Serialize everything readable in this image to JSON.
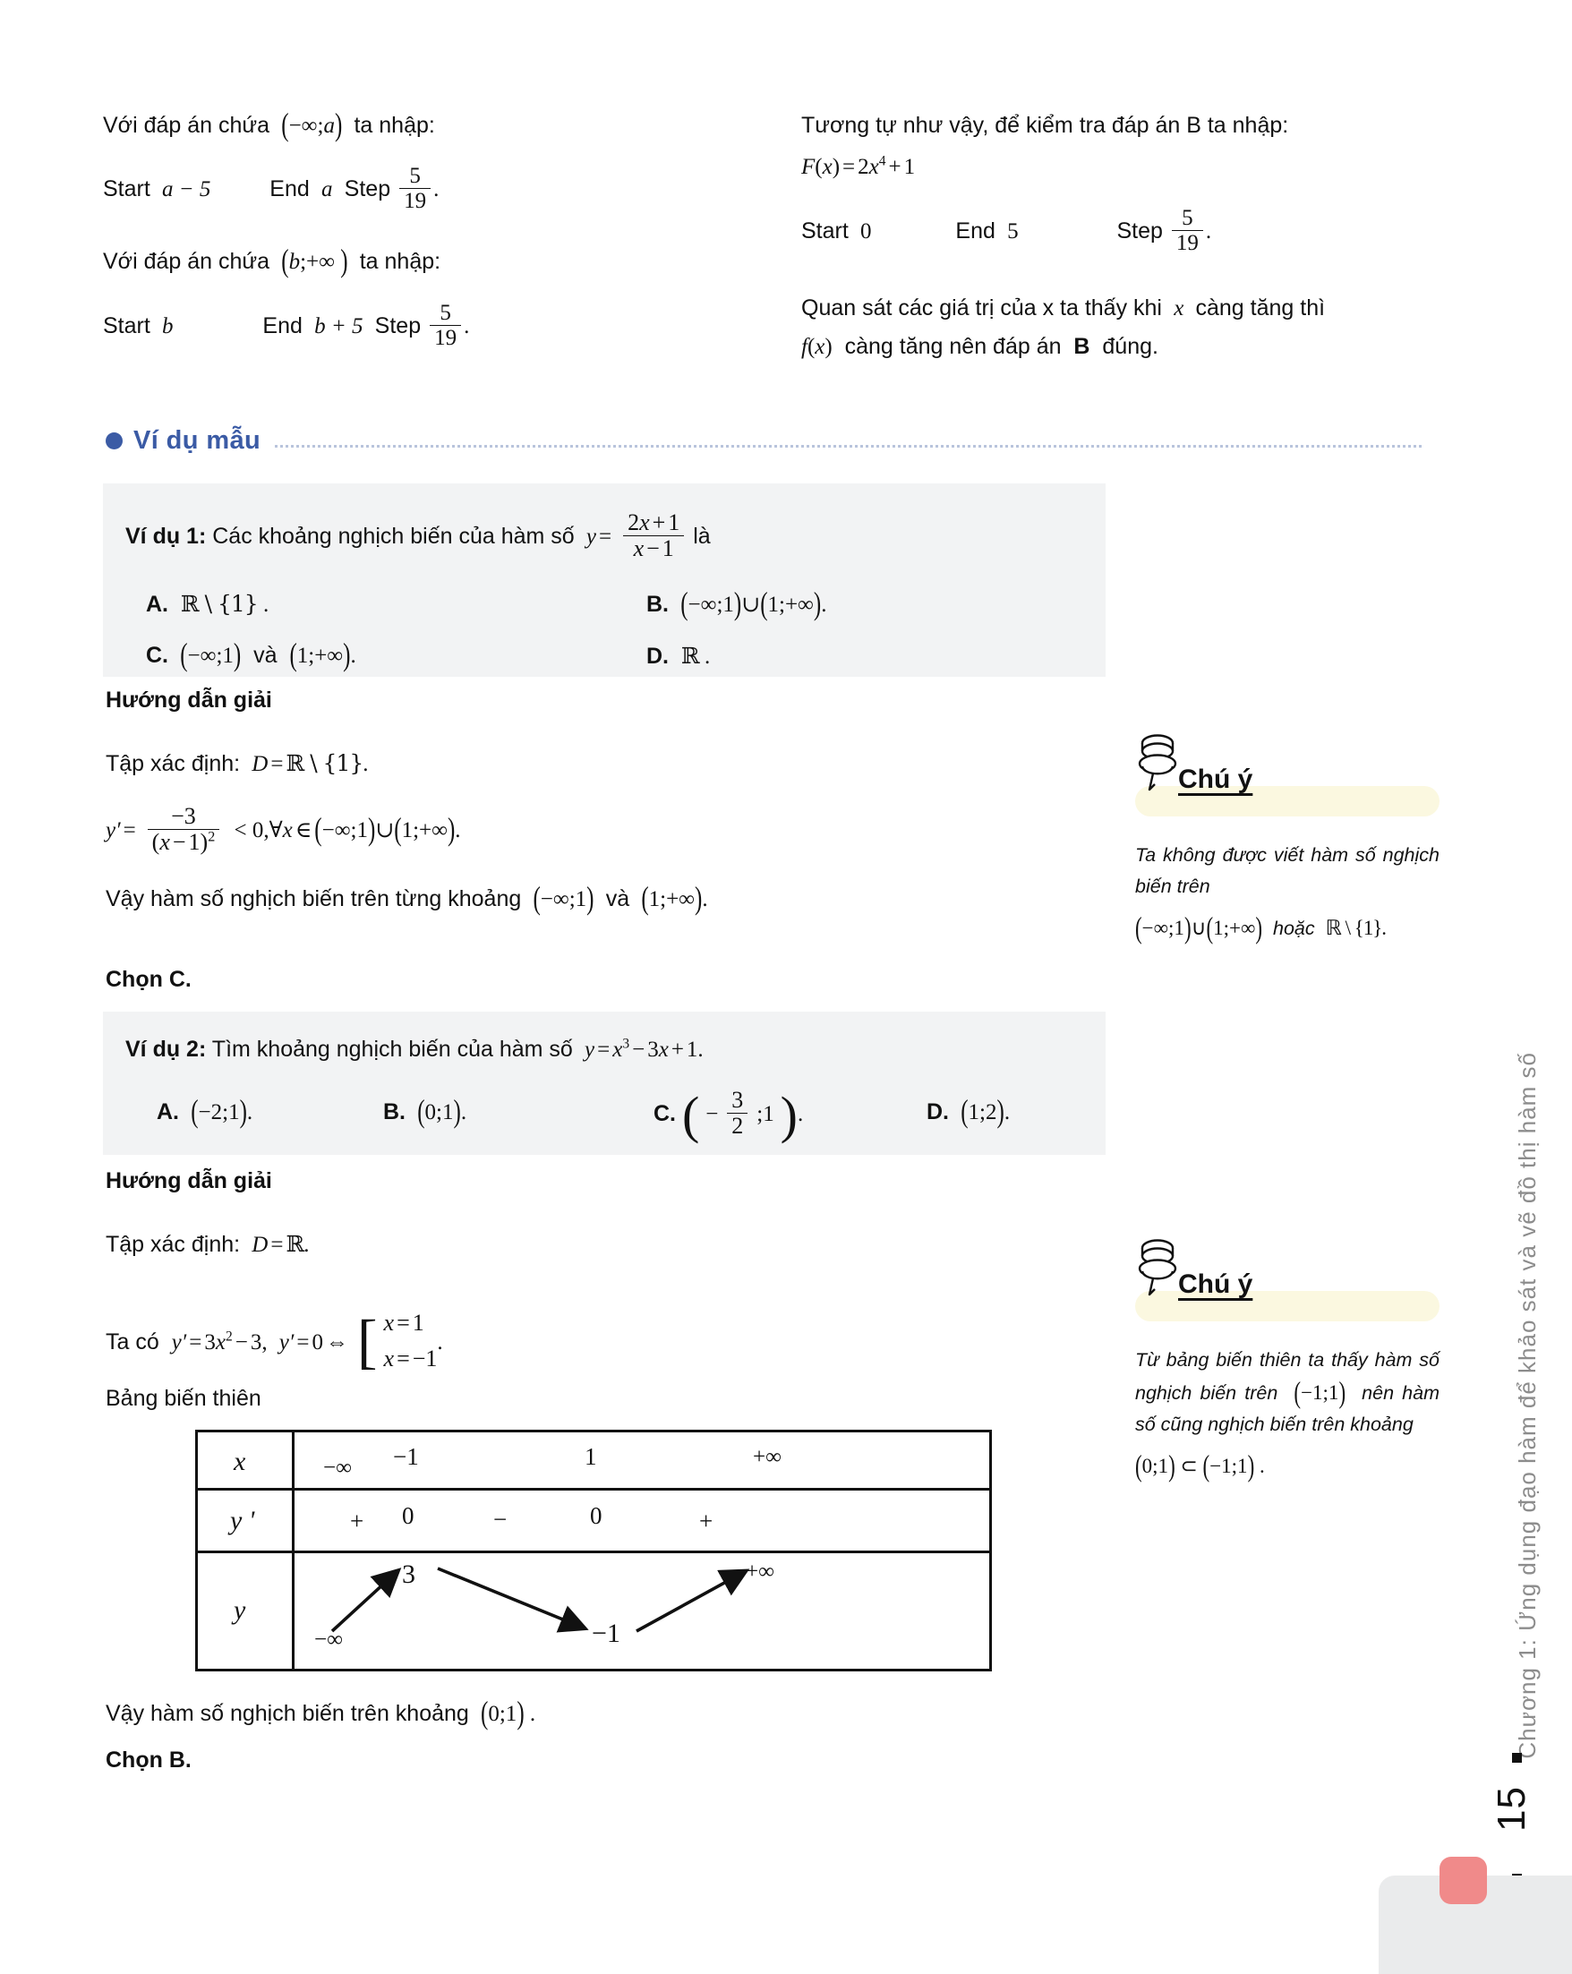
{
  "intro": {
    "left": [
      {
        "id": "l1",
        "text": "Với đáp án chứa (−∞;a) ta nhập:"
      },
      {
        "id": "l2",
        "text": "Start a − 5      End a  Step 5/19."
      },
      {
        "id": "l3",
        "text": "Với đáp án chứa (b;+∞ ) ta nhập:"
      },
      {
        "id": "l4",
        "text": "Start b          End b + 5  Step 5/19."
      }
    ],
    "right": [
      {
        "id": "r1",
        "text": "Tương tự như vậy, để kiểm tra đáp án B ta nhập:"
      },
      {
        "id": "r2",
        "text": "F(x) = 2x⁴ + 1"
      },
      {
        "id": "r3",
        "text": "Start 0          End 5            Step 5/19."
      },
      {
        "id": "r4",
        "text": "Quan sát các giá trị của x ta thấy khi x càng tăng thì f(x) càng tăng nên đáp án B đúng."
      }
    ],
    "labels": {
      "start": "Start",
      "end": "End",
      "step": "Step",
      "with_answer_a": "Với đáp án chứa",
      "with_answer_b": "Với đáp án chứa",
      "ta_nhap": "ta nhập:",
      "similarly": "Tương tự như vậy, để kiểm tra đáp án B ta nhập:",
      "observe_1": "Quan sát các giá trị của x ta thấy khi",
      "observe_2": "càng tăng thì",
      "observe_3": "càng tăng nên đáp án",
      "observe_4": "đúng.",
      "answer_letter_B": "B",
      "start_a_val": "a − 5",
      "end_a_val": "a",
      "start_b_val": "b",
      "end_b_val": "b + 5",
      "start_0": "0",
      "end_5": "5",
      "frac_num": "5",
      "frac_den": "19"
    }
  },
  "section": {
    "title": "Ví dụ mẫu"
  },
  "example1": {
    "label": "Ví dụ 1:",
    "stem_before": "Các khoảng nghịch biến của hàm số",
    "formula_num": "2x + 1",
    "formula_den": "x − 1",
    "stem_after": "là",
    "options": [
      {
        "key": "A.",
        "text": "ℝ \\ {1} ."
      },
      {
        "key": "B.",
        "text": "(−∞;1) ∪ (1;+∞)."
      },
      {
        "key": "C.",
        "text": "(−∞;1) và (1;+∞)."
      },
      {
        "key": "D.",
        "text": "ℝ ."
      }
    ]
  },
  "solution1": {
    "heading": "Hướng dẫn giải",
    "domain_label": "Tập xác định:",
    "domain_value": "D = ℝ \\ {1}.",
    "derivative": "y′ = −3 / (x − 1)² < 0, ∀x ∈ (−∞;1) ∪ (1;+∞).",
    "derivative_num": "−3",
    "derivative_den": "(x − 1)²",
    "derivative_tail": "< 0, ∀x ∈ (−∞;1) ∪ (1;+∞).",
    "conclusion": "Vậy hàm số nghịch biến trên từng khoảng (−∞;1) và (1;+∞).",
    "conclusion_before": "Vậy hàm số nghịch biến trên từng khoảng",
    "conclusion_interval1": "(−∞;1)",
    "conclusion_and": "và",
    "conclusion_interval2": "(1;+∞).",
    "choice": "Chọn C."
  },
  "note1": {
    "title": "Chú ý",
    "line1": "Ta không được viết hàm số nghịch biến trên",
    "line2": "(−∞;1)∪(1;+∞) hoặc ℝ \\ {1}."
  },
  "example2": {
    "label": "Ví dụ 2:",
    "stem": "Tìm khoảng nghịch biến của hàm số",
    "formula": "y = x³ − 3x + 1.",
    "options": [
      {
        "key": "A.",
        "text": "(−2;1)."
      },
      {
        "key": "B.",
        "text": "(0;1)."
      },
      {
        "key": "C.",
        "text": "(−3/2;1).",
        "frac_num": "3",
        "frac_den": "2"
      },
      {
        "key": "D.",
        "text": "(1;2)."
      }
    ]
  },
  "solution2": {
    "heading": "Hướng dẫn giải",
    "domain_label": "Tập xác định:",
    "domain_value": "D = ℝ.",
    "derivative_line": "Ta có  y′ = 3x² − 3,  y′ = 0 ⇔",
    "case1": "x = 1",
    "case2": "x = −1",
    "bbt_label": "Bảng biến thiên",
    "conclusion": "Vậy hàm số nghịch biến trên khoảng (0;1).",
    "conclusion_before": "Vậy hàm số nghịch biến trên khoảng",
    "conclusion_interval": "(0;1).",
    "choice": "Chọn B."
  },
  "note2": {
    "title": "Chú ý",
    "line1": "Từ bảng biến thiên ta thấy hàm số nghịch biến trên",
    "interval1": "(−1;1)",
    "line2": "nên hàm số cũng nghịch biến trên khoảng",
    "interval2": "(0;1) ⊂ (−1;1) ."
  },
  "chart_data": {
    "type": "table",
    "title": "Bảng biến thiên",
    "row_labels": [
      "x",
      "y '",
      "y"
    ],
    "x_values": [
      "−∞",
      "−1",
      "1",
      "+∞"
    ],
    "yprime_signs": [
      "+",
      "0",
      "−",
      "0",
      "+"
    ],
    "y_values": [
      "−∞",
      "3",
      "−1",
      "+∞"
    ],
    "y_arrows": [
      "up",
      "down",
      "up"
    ]
  },
  "footer": {
    "running_head": "Chương 1: Ứng dụng đạo hàm để khảo sát và vẽ đồ thị hàm số",
    "page_number": "15",
    "accent_color": "#f08a8a",
    "heading_color": "#3b5ba5",
    "box_color": "#f2f3f4",
    "note_color": "#fbf8e0"
  }
}
